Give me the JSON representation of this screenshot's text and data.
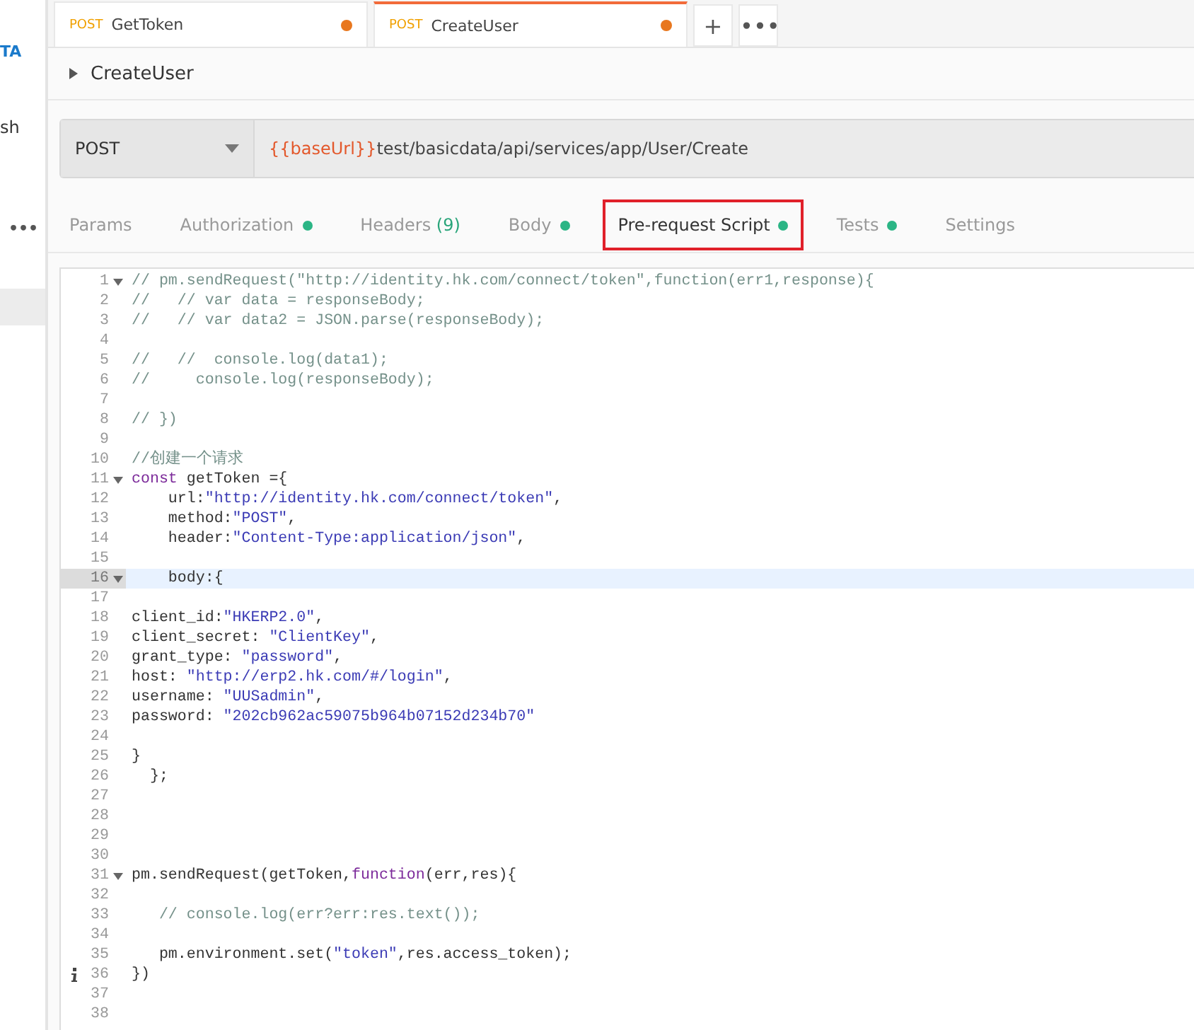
{
  "sidebar": {
    "items": [
      {
        "label": "TA",
        "kind": "link",
        "selected": false
      },
      {
        "label": "sh",
        "kind": "text",
        "selected": false
      },
      {
        "label": "•••",
        "kind": "more",
        "selected": false
      },
      {
        "kind": "blank",
        "selected": true
      }
    ]
  },
  "request_tabs": [
    {
      "method": "POST",
      "name": "GetToken",
      "selected": false,
      "unsaved": true
    },
    {
      "method": "POST",
      "name": "CreateUser",
      "selected": true,
      "unsaved": true
    }
  ],
  "tab_actions": [
    "+",
    "•••"
  ],
  "request_name": "CreateUser",
  "url_bar": {
    "method": "POST",
    "variable": "{{baseUrl}}",
    "path": "test/basicdata/api/services/app/User/Create"
  },
  "section_tabs": [
    {
      "label": "Params",
      "selected": false,
      "dot": false
    },
    {
      "label": "Authorization",
      "selected": false,
      "dot": true
    },
    {
      "label": "Headers",
      "count": "(9)",
      "selected": false,
      "dot": false
    },
    {
      "label": "Body",
      "selected": false,
      "dot": true
    },
    {
      "label": "Pre-request Script",
      "selected": true,
      "dot": true
    },
    {
      "label": "Tests",
      "selected": false,
      "dot": true
    },
    {
      "label": "Settings",
      "selected": false,
      "dot": false
    }
  ],
  "editor": {
    "lines": [
      {
        "n": "1",
        "fold": true,
        "seg": [
          {
            "kind": "comment",
            "t": "// pm.sendRequest(\"http://identity.hk.com/connect/token\",function(err1,response){"
          }
        ]
      },
      {
        "n": "2",
        "seg": [
          {
            "kind": "comment",
            "t": "//   // var data = responseBody;"
          }
        ]
      },
      {
        "n": "3",
        "seg": [
          {
            "kind": "comment",
            "t": "//   // var data2 = JSON.parse(responseBody);"
          }
        ]
      },
      {
        "n": "4"
      },
      {
        "n": "5",
        "seg": [
          {
            "kind": "comment",
            "t": "//   //  console.log(data1);"
          }
        ]
      },
      {
        "n": "6",
        "seg": [
          {
            "kind": "comment",
            "t": "//     console.log(responseBody);"
          }
        ]
      },
      {
        "n": "7"
      },
      {
        "n": "8",
        "seg": [
          {
            "kind": "comment",
            "t": "// })"
          }
        ]
      },
      {
        "n": "9"
      },
      {
        "n": "10",
        "seg": [
          {
            "kind": "comment",
            "t": "//创建一个请求"
          }
        ]
      },
      {
        "n": "11",
        "fold": true,
        "seg": [
          {
            "kind": "keyword",
            "t": "const"
          },
          {
            "kind": "plain",
            "t": " getToken ={"
          }
        ]
      },
      {
        "n": "12",
        "seg": [
          {
            "kind": "plain",
            "t": "    url:"
          },
          {
            "kind": "string",
            "t": "\"http://identity.hk.com/connect/token\""
          },
          {
            "kind": "plain",
            "t": ","
          }
        ]
      },
      {
        "n": "13",
        "seg": [
          {
            "kind": "plain",
            "t": "    method:"
          },
          {
            "kind": "string",
            "t": "\"POST\""
          },
          {
            "kind": "plain",
            "t": ","
          }
        ]
      },
      {
        "n": "14",
        "seg": [
          {
            "kind": "plain",
            "t": "    header:"
          },
          {
            "kind": "string",
            "t": "\"Content-Type:application/json\""
          },
          {
            "kind": "plain",
            "t": ","
          }
        ]
      },
      {
        "n": "15"
      },
      {
        "n": "16",
        "fold": true,
        "selected": true,
        "seg": [
          {
            "kind": "plain",
            "t": "    body:{"
          }
        ]
      },
      {
        "n": "17"
      },
      {
        "n": "18",
        "seg": [
          {
            "kind": "plain",
            "t": "client_id:"
          },
          {
            "kind": "string",
            "t": "\"HKERP2.0\""
          },
          {
            "kind": "plain",
            "t": ","
          }
        ]
      },
      {
        "n": "19",
        "seg": [
          {
            "kind": "plain",
            "t": "client_secret: "
          },
          {
            "kind": "string",
            "t": "\"ClientKey\""
          },
          {
            "kind": "plain",
            "t": ","
          }
        ]
      },
      {
        "n": "20",
        "seg": [
          {
            "kind": "plain",
            "t": "grant_type: "
          },
          {
            "kind": "string",
            "t": "\"password\""
          },
          {
            "kind": "plain",
            "t": ","
          }
        ]
      },
      {
        "n": "21",
        "seg": [
          {
            "kind": "plain",
            "t": "host: "
          },
          {
            "kind": "string",
            "t": "\"http://erp2.hk.com/#/login\""
          },
          {
            "kind": "plain",
            "t": ","
          }
        ]
      },
      {
        "n": "22",
        "seg": [
          {
            "kind": "plain",
            "t": "username: "
          },
          {
            "kind": "string",
            "t": "\"UUSadmin\""
          },
          {
            "kind": "plain",
            "t": ","
          }
        ]
      },
      {
        "n": "23",
        "seg": [
          {
            "kind": "plain",
            "t": "password: "
          },
          {
            "kind": "string",
            "t": "\"202cb962ac59075b964b07152d234b70\""
          }
        ]
      },
      {
        "n": "24"
      },
      {
        "n": "25",
        "seg": [
          {
            "kind": "plain",
            "t": "}"
          }
        ]
      },
      {
        "n": "26",
        "seg": [
          {
            "kind": "plain",
            "t": "  };"
          }
        ]
      },
      {
        "n": "27"
      },
      {
        "n": "28"
      },
      {
        "n": "29"
      },
      {
        "n": "30"
      },
      {
        "n": "31",
        "fold": true,
        "seg": [
          {
            "kind": "plain",
            "t": "pm.sendRequest(getToken,"
          },
          {
            "kind": "keyword",
            "t": "function"
          },
          {
            "kind": "plain",
            "t": "(err,res){"
          }
        ]
      },
      {
        "n": "32"
      },
      {
        "n": "33",
        "seg": [
          {
            "kind": "comment",
            "t": "   // console.log(err?err:res.text());"
          }
        ]
      },
      {
        "n": "34"
      },
      {
        "n": "35",
        "seg": [
          {
            "kind": "plain",
            "t": "   pm.environment.set("
          },
          {
            "kind": "string",
            "t": "\"token\""
          },
          {
            "kind": "plain",
            "t": ",res.access_token);"
          }
        ]
      },
      {
        "n": "36",
        "info": true,
        "seg": [
          {
            "kind": "plain",
            "t": "})"
          }
        ]
      },
      {
        "n": "37"
      },
      {
        "n": "38"
      }
    ]
  }
}
